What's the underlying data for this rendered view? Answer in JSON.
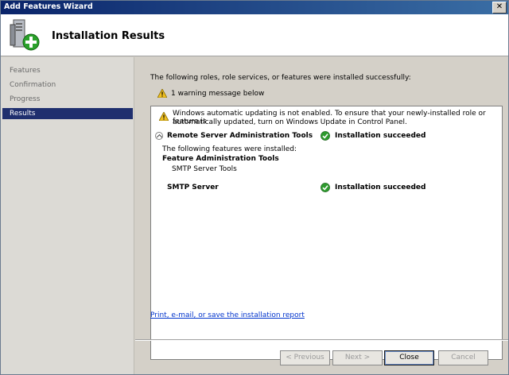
{
  "window": {
    "title": "Add Features Wizard",
    "close_glyph": "✕"
  },
  "header": {
    "title": "Installation Results"
  },
  "sidebar": {
    "steps": [
      {
        "label": "Features",
        "active": false
      },
      {
        "label": "Confirmation",
        "active": false
      },
      {
        "label": "Progress",
        "active": false
      },
      {
        "label": "Results",
        "active": true
      }
    ]
  },
  "main": {
    "intro": "The following roles, role services, or features were installed successfully:",
    "warning_summary": "1 warning message below",
    "warning_detail_line1": "Windows automatic updating is not enabled. To ensure that your newly-installed role or feature is",
    "warning_detail_line2": "automatically updated, turn on Windows Update in Control Panel.",
    "items": [
      {
        "name": "Remote Server Administration Tools",
        "status": "Installation succeeded",
        "details_heading": "The following features were installed:",
        "group": "Feature Administration Tools",
        "sub": "SMTP Server Tools"
      },
      {
        "name": "SMTP Server",
        "status": "Installation succeeded"
      }
    ],
    "report_link": "Print, e-mail, or save the installation report"
  },
  "buttons": {
    "previous": "< Previous",
    "next": "Next >",
    "close": "Close",
    "cancel": "Cancel"
  },
  "colors": {
    "title_bar": "#0a246a",
    "active_step": "#1f2f6e",
    "success": "#2e9a2e",
    "warning": "#f0c020",
    "link": "#0033cc"
  },
  "icons": {
    "header": "server-add-icon",
    "warning": "warning-icon",
    "success": "success-check-icon",
    "collapse": "collapse-icon"
  }
}
